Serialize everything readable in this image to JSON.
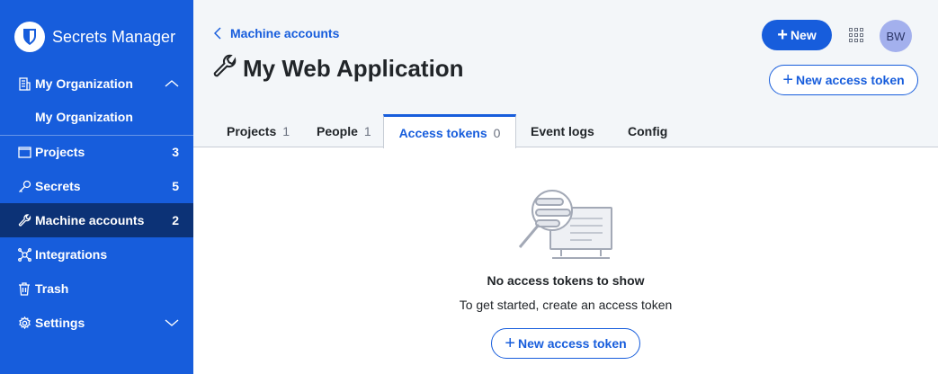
{
  "sidebar": {
    "brand": "Secrets Manager",
    "org_label": "My Organization",
    "org_sub": "My Organization",
    "items": [
      {
        "label": "Projects",
        "count": "3"
      },
      {
        "label": "Secrets",
        "count": "5"
      },
      {
        "label": "Machine accounts",
        "count": "2"
      },
      {
        "label": "Integrations",
        "count": ""
      },
      {
        "label": "Trash",
        "count": ""
      },
      {
        "label": "Settings",
        "count": ""
      }
    ]
  },
  "header": {
    "breadcrumb": "Machine accounts",
    "title": "My Web Application",
    "new_button": "New",
    "avatar_initials": "BW",
    "new_token_button": "New access token"
  },
  "tabs": [
    {
      "label": "Projects",
      "count": "1"
    },
    {
      "label": "People",
      "count": "1"
    },
    {
      "label": "Access tokens",
      "count": "0"
    },
    {
      "label": "Event logs",
      "count": ""
    },
    {
      "label": "Config",
      "count": ""
    }
  ],
  "empty_state": {
    "title": "No access tokens to show",
    "subtitle": "To get started, create an access token",
    "button": "New access token"
  },
  "colors": {
    "brand": "#175ddc",
    "sidebar_active": "#0c3276",
    "avatar": "#a3b0ed"
  }
}
